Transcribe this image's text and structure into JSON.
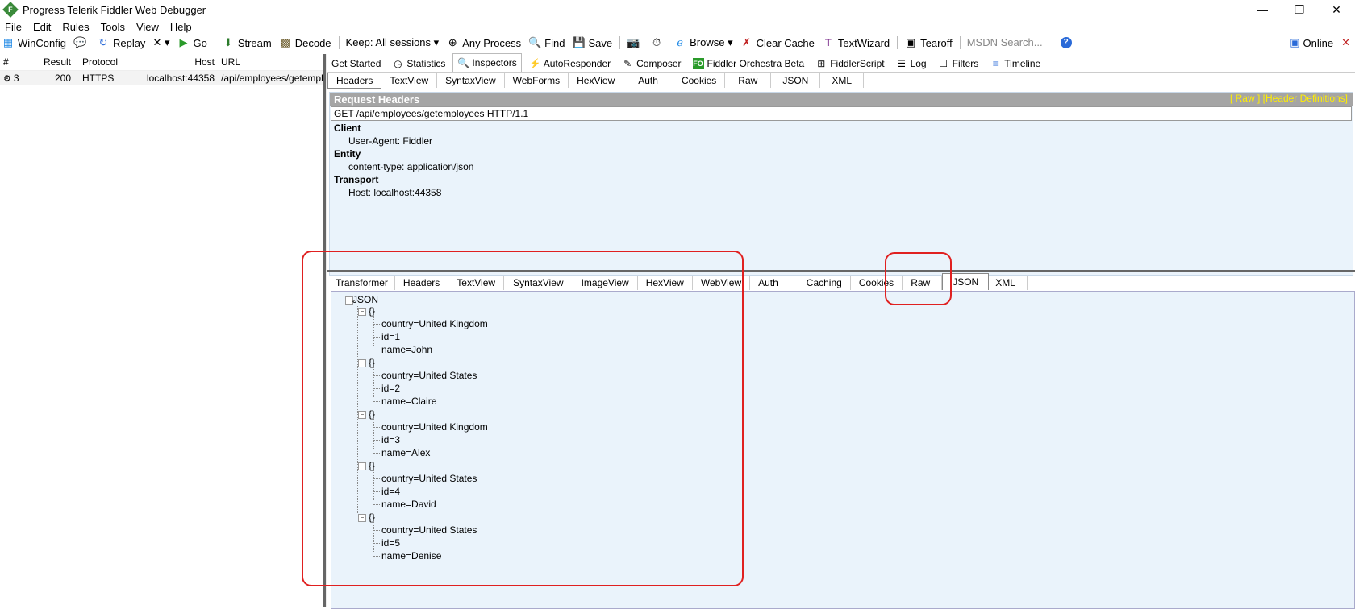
{
  "window": {
    "title": "Progress Telerik Fiddler Web Debugger",
    "minimize": "—",
    "restore": "❐",
    "close": "✕"
  },
  "menu": [
    "File",
    "Edit",
    "Rules",
    "Tools",
    "View",
    "Help"
  ],
  "toolbar": {
    "winconfig": "WinConfig",
    "replay": "Replay",
    "remove": "✕ ▾",
    "go": "Go",
    "stream": "Stream",
    "decode": "Decode",
    "keep": "Keep: All sessions ▾",
    "any_process": "Any Process",
    "find": "Find",
    "save": "Save",
    "browse": "Browse ▾",
    "clear_cache": "Clear Cache",
    "textwizard": "TextWizard",
    "tearoff": "Tearoff",
    "search_placeholder": "MSDN Search...",
    "online": "Online"
  },
  "sessions": {
    "headers": {
      "num": "#",
      "result": "Result",
      "protocol": "Protocol",
      "host": "Host",
      "url": "URL"
    },
    "rows": [
      {
        "num": "3",
        "result": "200",
        "protocol": "HTTPS",
        "host": "localhost:44358",
        "url": "/api/employees/getemplo"
      }
    ]
  },
  "main_tabs": [
    "Get Started",
    "Statistics",
    "Inspectors",
    "AutoResponder",
    "Composer",
    "Fiddler Orchestra Beta",
    "FiddlerScript",
    "Log",
    "Filters",
    "Timeline"
  ],
  "request_tabs": [
    "Headers",
    "TextView",
    "SyntaxView",
    "WebForms",
    "HexView",
    "Auth",
    "Cookies",
    "Raw",
    "JSON",
    "XML"
  ],
  "request": {
    "title": "Request Headers",
    "links": "[ Raw ]    [Header Definitions]",
    "line": "GET /api/employees/getemployees HTTP/1.1",
    "groups": [
      {
        "name": "Client",
        "value": "User-Agent: Fiddler"
      },
      {
        "name": "Entity",
        "value": "content-type: application/json"
      },
      {
        "name": "Transport",
        "value": "Host: localhost:44358"
      }
    ]
  },
  "response_tabs": [
    "Transformer",
    "Headers",
    "TextView",
    "SyntaxView",
    "ImageView",
    "HexView",
    "WebView",
    "Auth",
    "Caching",
    "Cookies",
    "Raw",
    "JSON",
    "XML"
  ],
  "json_tree": {
    "root": "JSON",
    "object_label": "{}",
    "items": [
      {
        "country": "country=United Kingdom",
        "id": "id=1",
        "name": "name=John"
      },
      {
        "country": "country=United States",
        "id": "id=2",
        "name": "name=Claire"
      },
      {
        "country": "country=United Kingdom",
        "id": "id=3",
        "name": "name=Alex"
      },
      {
        "country": "country=United States",
        "id": "id=4",
        "name": "name=David"
      },
      {
        "country": "country=United States",
        "id": "id=5",
        "name": "name=Denise"
      }
    ]
  },
  "colors": {
    "highlight": "#e02020",
    "panel_bg": "#eaf3fb",
    "header_bar": "#a5a5a5",
    "link_yellow": "#ffee00"
  }
}
